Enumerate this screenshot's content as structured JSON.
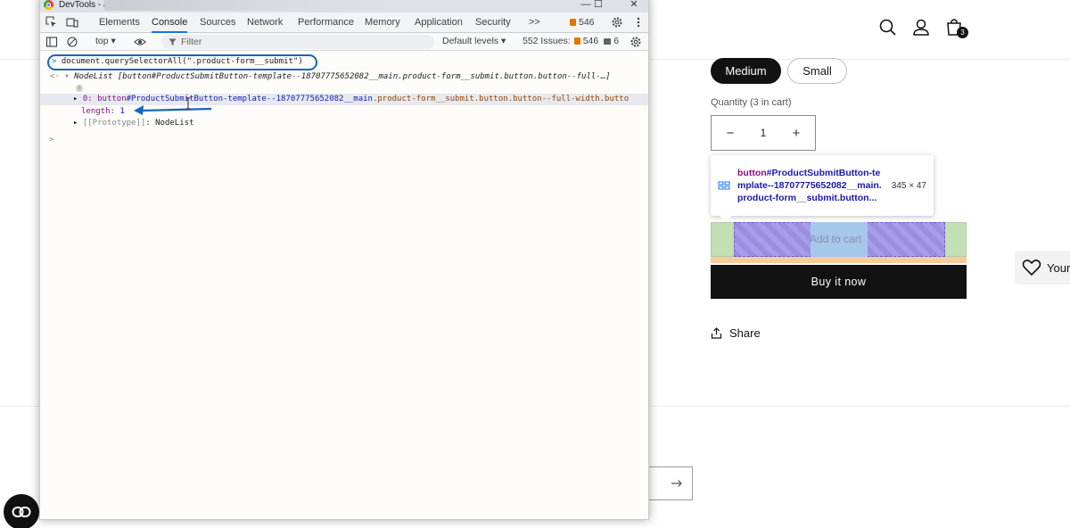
{
  "store": {
    "cart_count": "3",
    "size_options": [
      {
        "label": "Medium",
        "selected": true
      },
      {
        "label": "Small",
        "selected": false
      }
    ],
    "quantity_label": "Quantity (3 in cart)",
    "quantity_value": "1",
    "minus": "−",
    "plus": "+",
    "add_to_cart": "Add to cart",
    "buy_now": "Buy it now",
    "share": "Share",
    "wishlist": "Your",
    "inspect_tooltip": {
      "tag": "button",
      "selector_rest": "#ProductSubmitButton-template--18707775652082__main.product-form__submit.button...",
      "size": "345 × 47"
    }
  },
  "devtools": {
    "title": "DevTools - a",
    "tabs": [
      "Elements",
      "Console",
      "Sources",
      "Network",
      "Performance",
      "Memory",
      "Application",
      "Security"
    ],
    "active_tab": "Console",
    "more_tabs": ">>",
    "error_count": "546",
    "toolbar": {
      "context": "top ▾",
      "filter_placeholder": "Filter",
      "levels": "Default levels ▾",
      "issues_label": "552 Issues:",
      "issues_warn": "546",
      "issues_info": "6"
    },
    "console": {
      "command": "document.querySelectorAll(\".product-form__submit\")",
      "result_summary": "NodeList [button#ProductSubmitButton-template--18707775652082__main.product-form__submit.button.button--full-…]",
      "item0_key": "0:",
      "item0_tag": "button",
      "item0_id": "#ProductSubmitButton-template--18707775652082__main",
      "item0_cls": ".product-form__submit.button.button--full-width.butto",
      "length_key": "length:",
      "length_val": "1",
      "prototype_key": "[[Prototype]]",
      "prototype_val": ": NodeList",
      "prompt": ">"
    }
  },
  "colors": {
    "accent": "#1a73e8",
    "annotation": "#1565c0",
    "store_dark": "#121212"
  }
}
